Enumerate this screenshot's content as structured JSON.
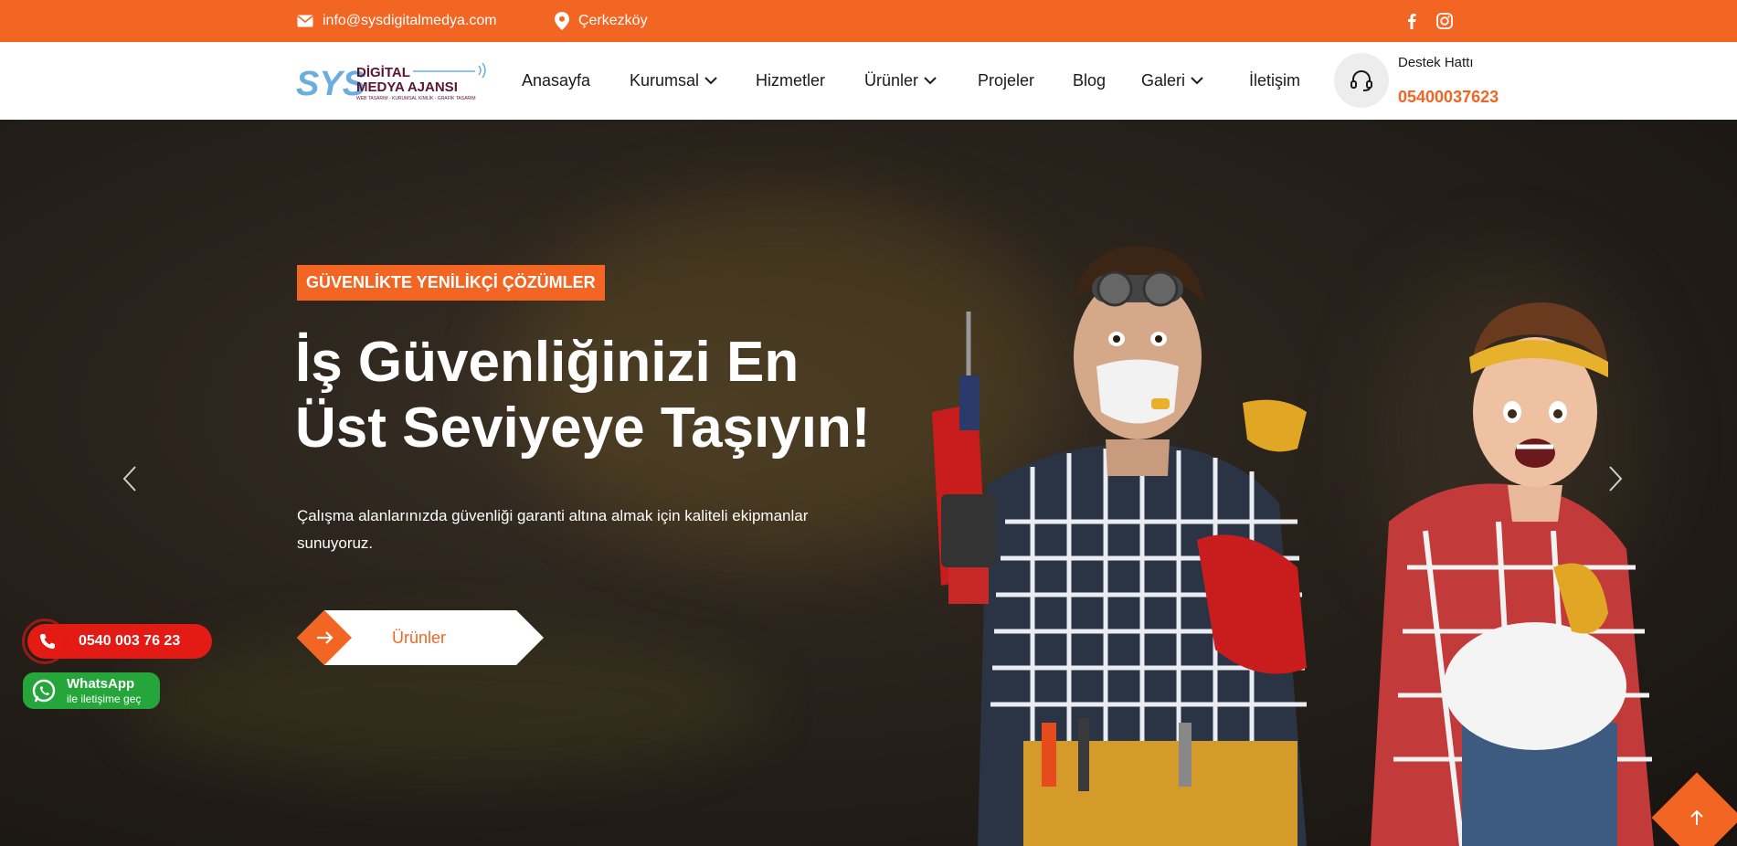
{
  "colors": {
    "accent": "#f26522",
    "call": "#e31b14",
    "whatsapp": "#25a63a"
  },
  "topbar": {
    "email": "info@sysdigitalmedya.com",
    "email_icon": "envelope-icon",
    "location": "Çerkezköy",
    "location_icon": "map-pin-icon",
    "social": [
      "facebook-icon",
      "instagram-icon"
    ]
  },
  "header": {
    "logo": {
      "mark": "SYS",
      "line1": "DİGİTAL",
      "line2": "MEDYA AJANSI",
      "tagline": "WEB TASARIM - KURUMSAL KİMLİK - GRAFİK TASARIM"
    },
    "nav": [
      {
        "label": "Anasayfa"
      },
      {
        "label": "Kurumsal"
      },
      {
        "label": "Hizmetler"
      },
      {
        "label": "Ürünler"
      },
      {
        "label": "Projeler"
      },
      {
        "label": "Blog"
      },
      {
        "label": "Galeri"
      },
      {
        "label": "İletişim"
      }
    ],
    "support_icon": "headset-icon",
    "support_label": "Destek Hattı",
    "support_phone": "05400037623"
  },
  "hero": {
    "badge": "GÜVENLİKTE YENİLİKÇİ ÇÖZÜMLER",
    "headline_line1": "İş Güvenliğinizi En",
    "headline_line2": "Üst Seviyeye Taşıyın!",
    "subtext": "Çalışma alanlarınızda güvenliği garanti altına almak için kaliteli ekipmanlar sunuyoruz.",
    "cta_label": "Ürünler"
  },
  "floating": {
    "call_label": "0540 003 76 23",
    "whatsapp_title": "WhatsApp",
    "whatsapp_sub": "ile iletişime geç"
  }
}
